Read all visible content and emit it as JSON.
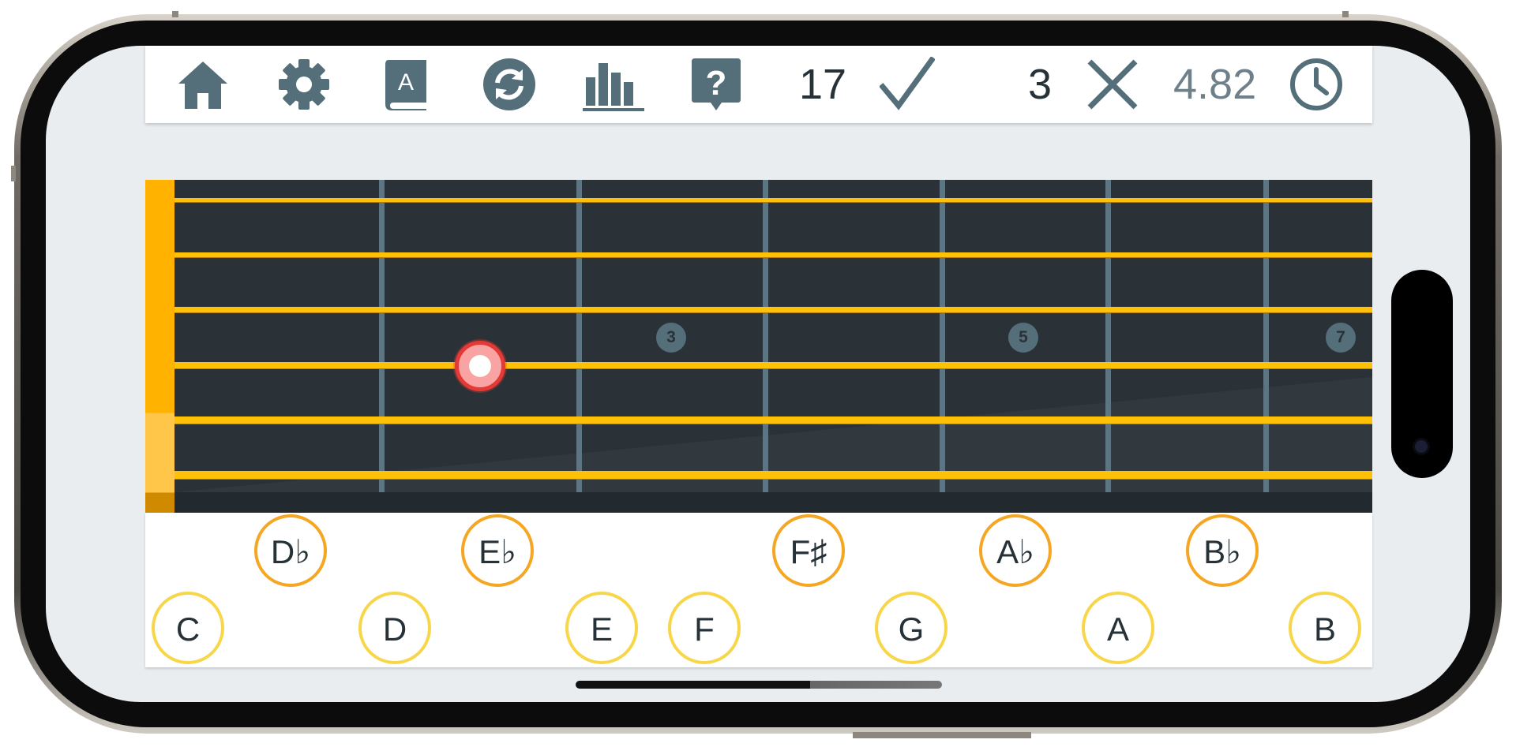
{
  "toolbar": {
    "icons": [
      "home-icon",
      "gear-icon",
      "book-icon",
      "refresh-icon",
      "stats-icon",
      "help-icon"
    ],
    "correct_count": "17",
    "wrong_count": "3",
    "avg_time": "4.82",
    "check_icon": "check-icon",
    "wrong_icon": "x-icon",
    "clock_icon": "clock-icon"
  },
  "fretboard": {
    "fret_markers": [
      "3",
      "5",
      "7"
    ],
    "string_count": 6,
    "highlighted_note": {
      "string": 4,
      "fret": 2
    }
  },
  "notes": {
    "accidentals": [
      "D♭",
      "E♭",
      "F♯",
      "A♭",
      "B♭"
    ],
    "naturals": [
      "C",
      "D",
      "E",
      "F",
      "G",
      "A",
      "B"
    ]
  },
  "colors": {
    "accent": "#ffb300",
    "string": "#ffc107",
    "fretboard": "#2a3238",
    "fret_wire": "#5d7582",
    "note_highlight": "#e53935",
    "icon": "#546e7a",
    "accidental_ring": "#f5a623",
    "natural_ring": "#f8d64a"
  }
}
